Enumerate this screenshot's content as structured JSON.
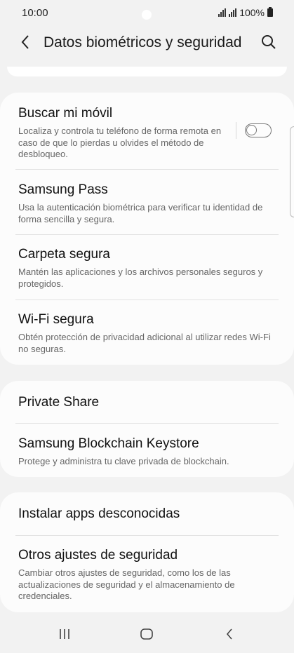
{
  "status": {
    "time": "10:00",
    "battery": "100%"
  },
  "header": {
    "title": "Datos biométricos y seguridad",
    "back_icon": "chevron-left-icon",
    "search_icon": "search-icon"
  },
  "group1": {
    "items": [
      {
        "title": "Buscar mi móvil",
        "subtitle": "Localiza y controla tu teléfono de forma remota en caso de que lo pierdas u olvides el método de desbloqueo.",
        "toggle_on": false
      },
      {
        "title": "Samsung Pass",
        "subtitle": "Usa la autenticación biométrica para verificar tu identidad de forma sencilla y segura."
      },
      {
        "title": "Carpeta segura",
        "subtitle": "Mantén las aplicaciones y los archivos personales seguros y protegidos."
      },
      {
        "title": "Wi-Fi segura",
        "subtitle": "Obtén protección de privacidad adicional al utilizar redes Wi-Fi no seguras."
      }
    ]
  },
  "group2": {
    "items": [
      {
        "title": "Private Share"
      },
      {
        "title": "Samsung Blockchain Keystore",
        "subtitle": "Protege y administra tu clave privada de blockchain."
      }
    ]
  },
  "group3": {
    "items": [
      {
        "title": "Instalar apps desconocidas"
      },
      {
        "title": "Otros ajustes de seguridad",
        "subtitle": "Cambiar otros ajustes de seguridad, como los de las actualizaciones de seguridad y el almacenamiento de credenciales."
      }
    ]
  },
  "navbar": {
    "recents_icon": "recents-icon",
    "home_icon": "home-icon",
    "back_icon": "back-icon"
  }
}
